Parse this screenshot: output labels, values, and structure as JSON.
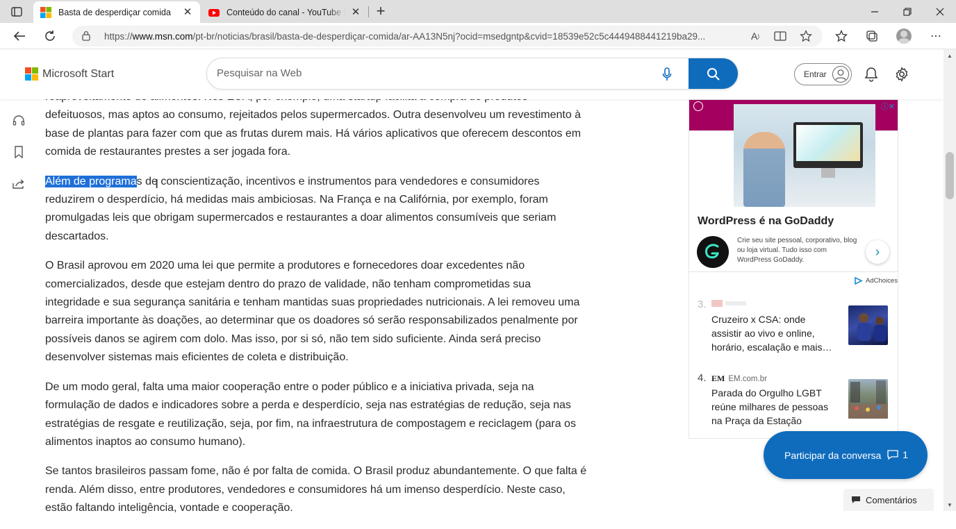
{
  "browser": {
    "tabs": [
      {
        "title": "Basta de desperdiçar comida",
        "active": true,
        "favicon": "msn-icon"
      },
      {
        "title": "Conteúdo do canal - YouTube Studio",
        "active": false,
        "favicon": "youtube-icon"
      }
    ],
    "url_prefix": "https://",
    "url_domain": "www.msn.com",
    "url_rest": "/pt-br/noticias/brasil/basta-de-desperdiçar-comida/ar-AA13N5nj?ocid=msedgntp&cvid=18539e52c5c4449488441219ba29..."
  },
  "header": {
    "brand": "Microsoft Start",
    "search_placeholder": "Pesquisar na Web",
    "signin_label": "Entrar"
  },
  "article": {
    "p0_line1": "reaproveitamento de alimentos. Nos EUA, por exemplo, uma startup facilita a compra de produtos",
    "p0_rest": "defeituosos, mas aptos ao consumo, rejeitados pelos supermercados. Outra desenvolveu um revestimento à base de plantas para fazer com que as frutas durem mais. Há vários aplicativos que oferecem descontos em comida de restaurantes prestes a ser jogada fora.",
    "p1_selected": "Além de programa",
    "p1_rest": "s de conscientização, incentivos e instrumentos para vendedores e consumidores reduzirem o desperdício, há medidas mais ambiciosas. Na França e na Califórnia, por exemplo, foram promulgadas leis que obrigam supermercados e restaurantes a doar alimentos consumíveis que seriam descartados.",
    "p2": "O Brasil aprovou em 2020 uma lei que permite a produtores e fornecedores doar excedentes não comercializados, desde que estejam dentro do prazo de validade, não tenham comprometidas sua integridade e sua segurança sanitária e tenham mantidas suas propriedades nutricionais. A lei removeu uma barreira importante às doações, ao determinar que os doadores só serão responsabilizados penalmente por possíveis danos se agirem com dolo. Mas isso, por si só, não tem sido suficiente. Ainda será preciso desenvolver sistemas mais eficientes de coleta e distribuição.",
    "p3": "De um modo geral, falta uma maior cooperação entre o poder público e a iniciativa privada, seja na formulação de dados e indicadores sobre a perda e desperdício, seja nas estratégias de redução, seja nas estratégias de resgate e reutilização, seja, por fim, na infraestrutura de compostagem e reciclagem (para os alimentos inaptos ao consumo humano).",
    "p4": "Se tantos brasileiros passam fome, não é por falta de comida. O Brasil produz abundantemente. O que falta é renda. Além disso, entre produtores, vendedores e consumidores há um imenso desperdício. Neste caso, estão faltando inteligência, vontade e cooperação."
  },
  "ad": {
    "title": "WordPress é na GoDaddy",
    "text": "Crie seu site pessoal, corporativo, blog ou loja virtual. Tudo isso com WordPress GoDaddy.",
    "adchoices": "AdChoices",
    "brand_color": "#a3005f"
  },
  "trending": [
    {
      "number": "3.",
      "source": "",
      "headline": "Cruzeiro x CSA: onde assistir ao vivo e online, horário, escalação e mais…"
    },
    {
      "number": "4.",
      "source_logo": "EM",
      "source": "EM.com.br",
      "headline": "Parada do Orgulho LGBT reúne milhares de pessoas na Praça da Estação"
    }
  ],
  "conversation": {
    "label": "Participar da conversa",
    "count": "1"
  },
  "comments_label": "Comentários",
  "colors": {
    "accent": "#0f6cbd",
    "selection": "#1f6fd8"
  }
}
